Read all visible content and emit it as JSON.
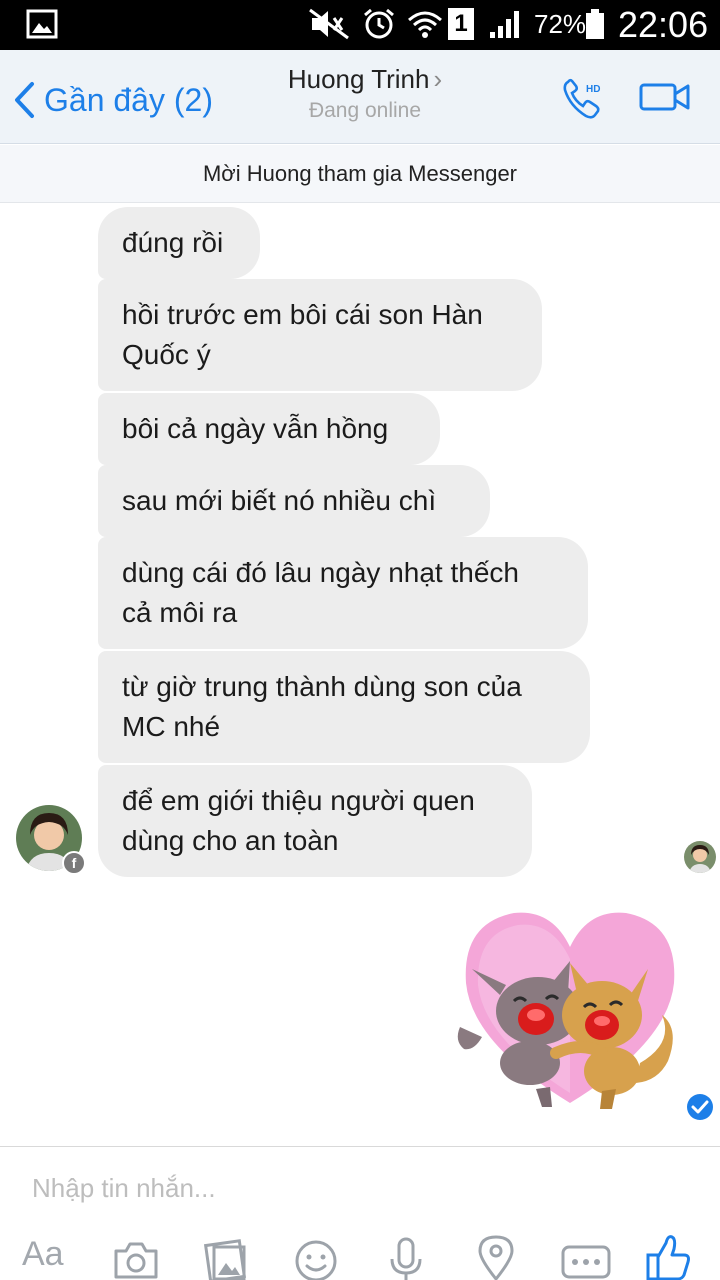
{
  "status_bar": {
    "battery": "72%",
    "time": "22:06",
    "sim_slot": "1",
    "icons": [
      "gallery-icon",
      "mute-icon",
      "alarm-icon",
      "wifi-icon",
      "sim-icon",
      "signal-icon",
      "battery-icon"
    ]
  },
  "header": {
    "back_label": "Gần đây (2)",
    "contact_name": "Huong Trinh",
    "contact_status": "Đang online",
    "call_badge": "HD",
    "accent_color": "#1d7fe8"
  },
  "invite_banner": "Mời Huong tham gia Messenger",
  "messages": [
    {
      "line1": "đúng rồi",
      "line2": ""
    },
    {
      "line1": "hồi trước em bôi cái son Hàn",
      "line2": "Quốc ý"
    },
    {
      "line1": "bôi cả ngày vẫn hồng",
      "line2": ""
    },
    {
      "line1": "sau mới biết nó nhiều chì",
      "line2": ""
    },
    {
      "line1": "dùng cái đó lâu ngày nhạt thếch",
      "line2": "cả môi ra"
    },
    {
      "line1": "từ giờ trung thành dùng son của",
      "line2": "MC nhé"
    },
    {
      "line1": "để em giới thiệu người quen",
      "line2": "dùng cho an toàn"
    }
  ],
  "composer": {
    "placeholder": "Nhập tin nhắn...",
    "aa_label": "Aa",
    "tools": [
      "camera-icon",
      "gallery-icon",
      "emoji-icon",
      "microphone-icon",
      "location-icon",
      "more-icon",
      "like-icon"
    ]
  }
}
